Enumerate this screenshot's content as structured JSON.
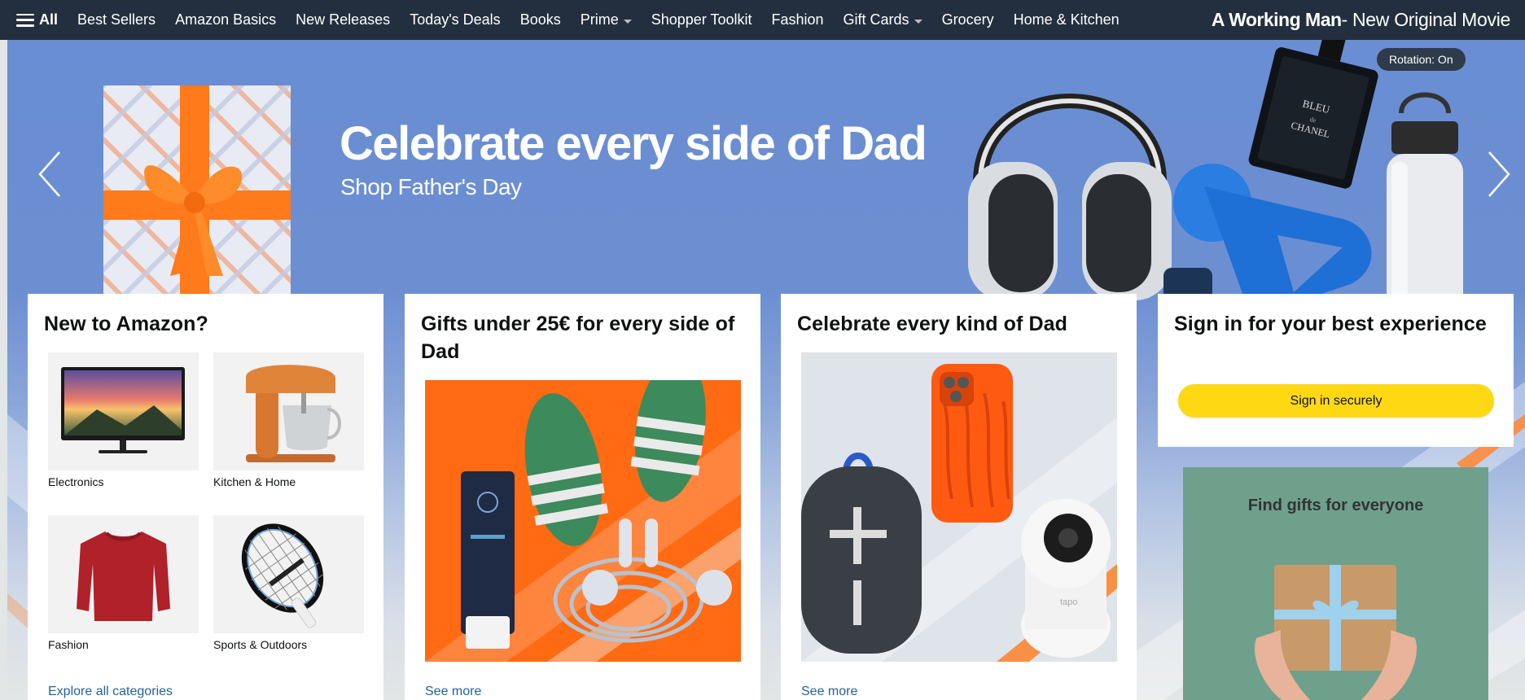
{
  "nav": {
    "all_label": "All",
    "items": [
      {
        "label": "Best Sellers",
        "caret": false
      },
      {
        "label": "Amazon Basics",
        "caret": false
      },
      {
        "label": "New Releases",
        "caret": false
      },
      {
        "label": "Today's Deals",
        "caret": false
      },
      {
        "label": "Books",
        "caret": false
      },
      {
        "label": "Prime",
        "caret": true
      },
      {
        "label": "Shopper Toolkit",
        "caret": false
      },
      {
        "label": "Fashion",
        "caret": false
      },
      {
        "label": "Gift Cards",
        "caret": true
      },
      {
        "label": "Grocery",
        "caret": false
      },
      {
        "label": "Home & Kitchen",
        "caret": false
      }
    ],
    "promo_bold": "A Working Man",
    "promo_rest": " - New Original Movie"
  },
  "hero": {
    "title": "Celebrate every side of Dad",
    "subtitle": "Shop Father's Day",
    "rotation": "Rotation: On",
    "perfume_label_1": "BLEU",
    "perfume_label_2": "de",
    "perfume_label_3": "CHANEL"
  },
  "cards": {
    "new_to_amazon": {
      "title": "New to Amazon?",
      "categories": [
        {
          "label": "Electronics",
          "icon": "monitor-icon"
        },
        {
          "label": "Kitchen & Home",
          "icon": "stand-mixer-icon"
        },
        {
          "label": "Fashion",
          "icon": "sweater-icon"
        },
        {
          "label": "Sports & Outdoors",
          "icon": "tennis-racket-icon"
        }
      ],
      "link": "Explore all categories"
    },
    "gifts": {
      "title": "Gifts under 25€ for every side of Dad",
      "link": "See more"
    },
    "celebrate": {
      "title": "Celebrate every kind of Dad",
      "link": "See more",
      "camera_brand": "tapo"
    },
    "signin": {
      "title": "Sign in for your best experience",
      "button": "Sign in securely"
    },
    "gift_ad": {
      "title": "Find gifts for everyone"
    }
  },
  "colors": {
    "nav_bg": "#232f3e",
    "hero_bg": "#6a8ed3",
    "signin_button": "#ffd814",
    "link": "#2162a1",
    "accent_orange": "#ff6a13"
  }
}
